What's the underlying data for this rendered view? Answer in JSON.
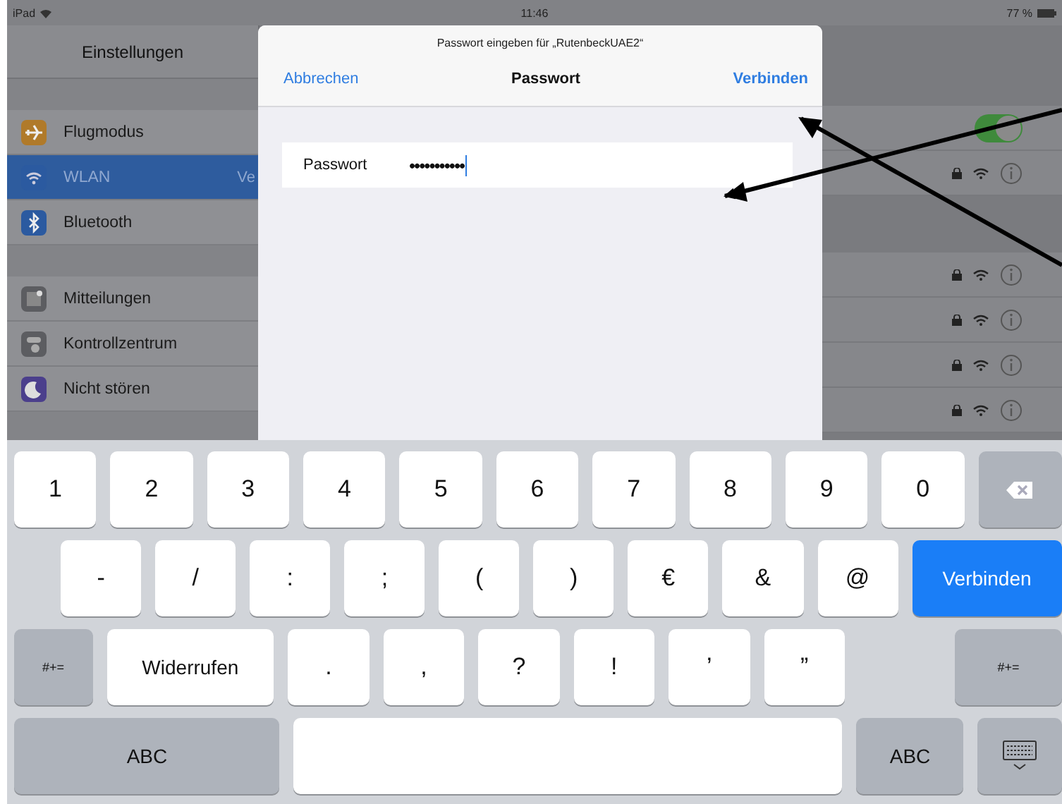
{
  "status_bar": {
    "device": "iPad",
    "time": "11:46",
    "battery": "77 %"
  },
  "sidebar": {
    "title": "Einstellungen",
    "groups": [
      [
        {
          "label": "Flugmodus",
          "color": "#b07a2a",
          "kind": "plane",
          "selected": false
        },
        {
          "label": "WLAN",
          "value": "Ve",
          "color": "#2b5aa0",
          "kind": "wifi",
          "selected": true
        },
        {
          "label": "Bluetooth",
          "color": "#2b5aa0",
          "kind": "bluetooth",
          "selected": false
        }
      ],
      [
        {
          "label": "Mitteilungen",
          "color": "#5c5d61",
          "kind": "notes",
          "selected": false
        },
        {
          "label": "Kontrollzentrum",
          "color": "#5c5d61",
          "kind": "switches",
          "selected": false
        },
        {
          "label": "Nicht stören",
          "color": "#4b3f8c",
          "kind": "moon",
          "selected": false
        }
      ]
    ]
  },
  "detail": {
    "groups": [
      [
        {
          "kind": "toggle",
          "on": true
        },
        {
          "kind": "network"
        }
      ],
      [
        {
          "kind": "network"
        },
        {
          "kind": "network"
        },
        {
          "kind": "network"
        },
        {
          "kind": "network"
        }
      ]
    ]
  },
  "dialog": {
    "subtitle": "Passwort eingeben für „RutenbeckUAE2“",
    "cancel": "Abbrechen",
    "title": "Passwort",
    "confirm": "Verbinden",
    "field": {
      "label": "Passwort",
      "value": "•••••••••••"
    }
  },
  "keyboard": {
    "key_groups": [
      [
        {
          "label": "1",
          "kind": "char"
        },
        {
          "label": "2",
          "kind": "char"
        },
        {
          "label": "3",
          "kind": "char"
        },
        {
          "label": "4",
          "kind": "char"
        },
        {
          "label": "5",
          "kind": "char"
        },
        {
          "label": "6",
          "kind": "char"
        },
        {
          "label": "7",
          "kind": "char"
        },
        {
          "label": "8",
          "kind": "char"
        },
        {
          "label": "9",
          "kind": "char"
        },
        {
          "label": "0",
          "kind": "char"
        },
        {
          "kind": "delete"
        }
      ],
      [
        {
          "label": "-",
          "kind": "char"
        },
        {
          "label": "/",
          "kind": "char"
        },
        {
          "label": ":",
          "kind": "char"
        },
        {
          "label": ";",
          "kind": "char"
        },
        {
          "label": "(",
          "kind": "char"
        },
        {
          "label": ")",
          "kind": "char"
        },
        {
          "label": "€",
          "kind": "char"
        },
        {
          "label": "&",
          "kind": "char"
        },
        {
          "label": "@",
          "kind": "char"
        },
        {
          "label": "Verbinden",
          "kind": "action"
        }
      ],
      [
        {
          "label": "#+=",
          "kind": "function"
        },
        {
          "label": "Widerrufen",
          "kind": "wide"
        },
        {
          "label": ".",
          "kind": "char"
        },
        {
          "label": ",",
          "kind": "char"
        },
        {
          "label": "?",
          "kind": "char"
        },
        {
          "label": "!",
          "kind": "char"
        },
        {
          "label": "’",
          "kind": "char"
        },
        {
          "label": "”",
          "kind": "char"
        },
        {
          "label": "#+=",
          "kind": "function"
        }
      ],
      [
        {
          "label": "ABC",
          "kind": "mode"
        },
        {
          "kind": "space"
        },
        {
          "label": "ABC",
          "kind": "function"
        },
        {
          "kind": "hide"
        }
      ]
    ]
  }
}
